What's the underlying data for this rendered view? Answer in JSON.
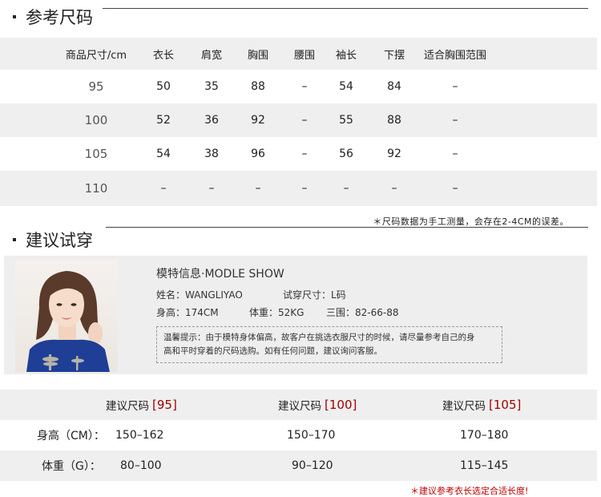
{
  "reference": {
    "title": "参考尺码",
    "headers": [
      "商品尺寸/cm",
      "衣长",
      "肩宽",
      "胸围",
      "腰围",
      "袖长",
      "下摆",
      "适合胸围范围"
    ],
    "rows": [
      [
        "95",
        "50",
        "35",
        "88",
        "–",
        "54",
        "84",
        "–"
      ],
      [
        "100",
        "52",
        "36",
        "92",
        "–",
        "55",
        "88",
        "–"
      ],
      [
        "105",
        "54",
        "38",
        "96",
        "–",
        "56",
        "92",
        "–"
      ],
      [
        "110",
        "–",
        "–",
        "–",
        "–",
        "–",
        "–",
        "–"
      ]
    ],
    "note": "＊尺码数据为手工测量，会存在2-4CM的误差。"
  },
  "recommend": {
    "title": "建议试穿",
    "model": {
      "heading": "模特信息·MODLE SHOW",
      "name_label": "姓名：WANGLIYAO",
      "size_label": "试穿尺寸：L码",
      "height_label": "身高：174CM",
      "weight_label": "体重：52KG",
      "measure_label": "三围：82-66-88",
      "tip_line1": "温馨提示：由于模特身体偏高，故客户在挑选衣服尺寸的时候，请尽量参考自己的身",
      "tip_line2": "高和平时穿着的尺码选购。如有任何问题，建议询问客服。"
    },
    "table": {
      "head_prefix": "建议尺码",
      "sizes": [
        "[95]",
        "[100]",
        "[105]"
      ],
      "rows": [
        {
          "label": "身高（CM）：",
          "values": [
            "150–162",
            "150–170",
            "170–180"
          ]
        },
        {
          "label": "体重（G）：",
          "values": [
            "80–100",
            "90–120",
            "115–145"
          ]
        }
      ]
    },
    "note": "＊建议参考衣长选定合适长度!"
  },
  "colors": {
    "accent_red": "#a00000",
    "row_shade": "#efefef"
  }
}
